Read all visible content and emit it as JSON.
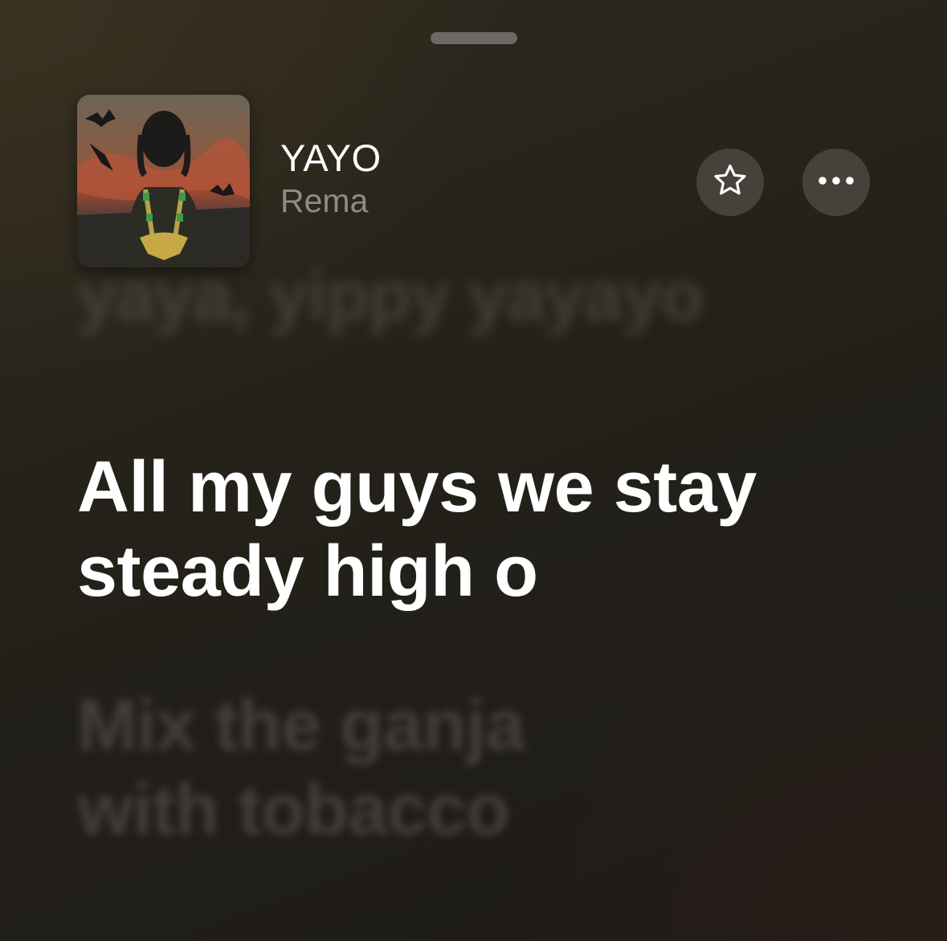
{
  "now_playing": {
    "title": "YAYO",
    "artist": "Rema",
    "artwork_icon": "album-artwork"
  },
  "controls": {
    "favorite_icon": "star-outline-icon",
    "more_icon": "ellipsis-icon"
  },
  "lyrics": {
    "previous_line": "yaya, yippy yayayo",
    "current_line": "All my guys we stay steady high o",
    "next_line": "Mix the ganja with tobacco"
  },
  "colors": {
    "current_lyric": "#ffffff",
    "artist_text": "#8f8c86",
    "button_bg": "#4a4740"
  }
}
